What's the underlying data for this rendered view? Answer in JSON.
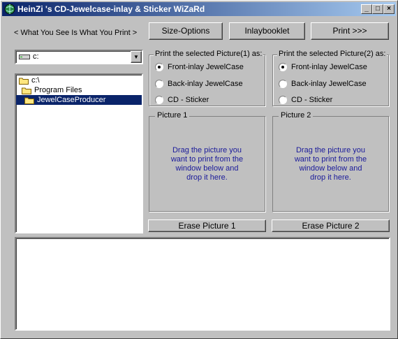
{
  "window": {
    "title": "HeinZi 's CD-Jewelcase-inlay & Sticker WiZaRd"
  },
  "toolbar": {
    "wysiwyg_label": "< What You See Is What You Print >",
    "size_options_label": "Size-Options",
    "inlaybooklet_label": "Inlaybooklet",
    "print_label": "Print >>>"
  },
  "drive_select": {
    "value": "c:"
  },
  "folder_tree": {
    "items": [
      {
        "label": "c:\\"
      },
      {
        "label": "Program Files"
      },
      {
        "label": "JewelCaseProducer"
      }
    ]
  },
  "picture1_options": {
    "legend": "Print the selected Picture(1) as:",
    "options": [
      "Front-inlay JewelCase",
      "Back-inlay JewelCase",
      "CD - Sticker"
    ],
    "selected": 0
  },
  "picture2_options": {
    "legend": "Print the selected Picture(2) as:",
    "options": [
      "Front-inlay JewelCase",
      "Back-inlay JewelCase",
      "CD - Sticker"
    ],
    "selected": 0
  },
  "picture1": {
    "legend": "Picture 1",
    "hint": "Drag the picture you\nwant to print from the\nwindow below and\ndrop it here.",
    "erase_label": "Erase Picture 1"
  },
  "picture2": {
    "legend": "Picture 2",
    "hint": "Drag the picture you\nwant to print from the\nwindow below and\ndrop it here.",
    "erase_label": "Erase Picture 2"
  },
  "colors": {
    "titlebar_start": "#0a246a",
    "hint_text": "#1a1a9a",
    "selection": "#0a246a"
  }
}
